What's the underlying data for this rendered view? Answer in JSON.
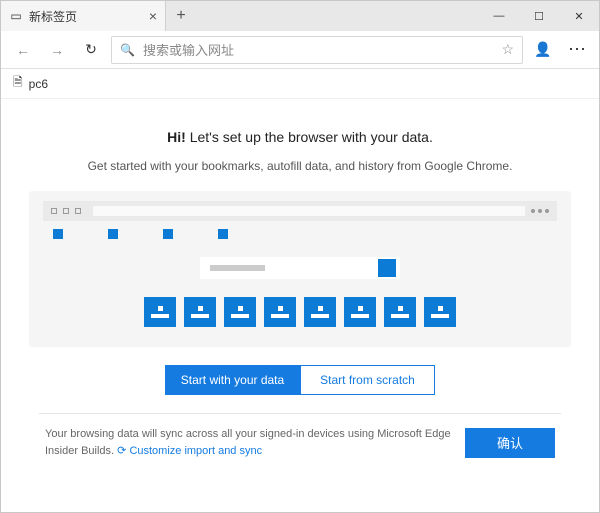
{
  "titlebar": {
    "tab_title": "新标签页",
    "close_glyph": "×",
    "newtab_glyph": "+",
    "min_glyph": "—",
    "max_glyph": "☐",
    "exit_glyph": "✕"
  },
  "toolbar": {
    "back_glyph": "←",
    "fwd_glyph": "→",
    "reload_glyph": "↻",
    "search_glyph": "🔍",
    "address_placeholder": "搜索或输入网址",
    "star_glyph": "☆",
    "profile_glyph": "👤",
    "more_glyph": "⋯"
  },
  "bookmarks": {
    "item0": "pc6",
    "file_glyph": "🗎"
  },
  "setup": {
    "hi": "Hi!",
    "headline_rest": " Let's set up the browser with your data.",
    "subtext": "Get started with your bookmarks, autofill data, and history from Google Chrome.",
    "primary_btn": "Start with your data",
    "secondary_btn": "Start from scratch"
  },
  "footer": {
    "sync_text": "Your browsing data will sync across all your signed-in devices using Microsoft Edge Insider Builds.",
    "link_text": "Customize import and sync",
    "sync_glyph": "⟳",
    "confirm": "确认"
  }
}
